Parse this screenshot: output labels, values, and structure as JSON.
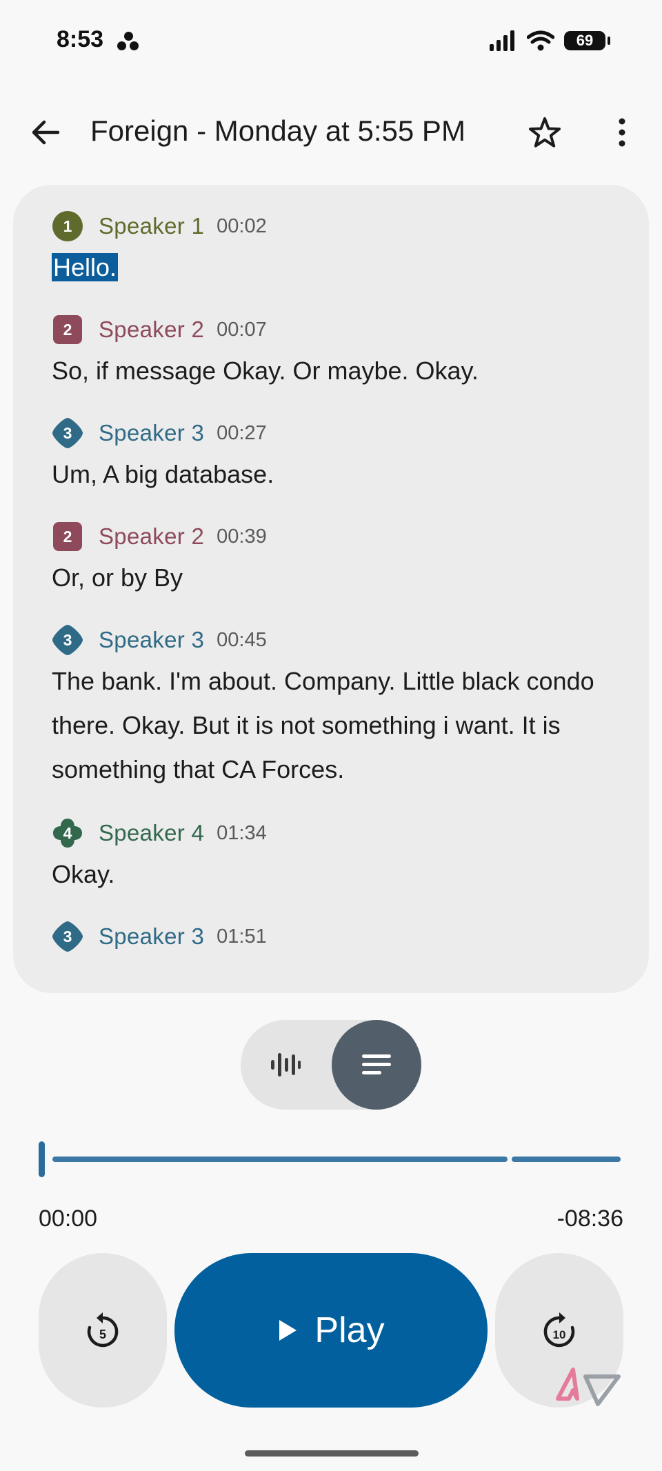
{
  "status_bar": {
    "time": "8:53",
    "battery": "69"
  },
  "header": {
    "title": "Foreign - Monday at 5:55 PM"
  },
  "transcript": [
    {
      "speaker_number": "1",
      "speaker": "Speaker 1",
      "time": "00:02",
      "text": "Hello.",
      "color": "#5f6b2c",
      "badge_shape": "circle"
    },
    {
      "speaker_number": "2",
      "speaker": "Speaker 2",
      "time": "00:07",
      "text": "So, if message Okay. Or maybe. Okay.",
      "color": "#8e4a5b",
      "badge_shape": "rounded-square"
    },
    {
      "speaker_number": "3",
      "speaker": "Speaker 3",
      "time": "00:27",
      "text": "Um, A big database.",
      "color": "#2f6a86",
      "badge_shape": "diamond"
    },
    {
      "speaker_number": "2",
      "speaker": "Speaker 2",
      "time": "00:39",
      "text": "Or, or by By",
      "color": "#8e4a5b",
      "badge_shape": "rounded-square"
    },
    {
      "speaker_number": "3",
      "speaker": "Speaker 3",
      "time": "00:45",
      "text": "The bank. I'm about. Company. Little black condo there. Okay. But it is not something i want. It is something that CA Forces.",
      "color": "#2f6a86",
      "badge_shape": "diamond"
    },
    {
      "speaker_number": "4",
      "speaker": "Speaker 4",
      "time": "01:34",
      "text": "Okay.",
      "color": "#32694d",
      "badge_shape": "clover"
    },
    {
      "speaker_number": "3",
      "speaker": "Speaker 3",
      "time": "01:51",
      "text": "",
      "color": "#2f6a86",
      "badge_shape": "diamond"
    }
  ],
  "player": {
    "current_time": "00:00",
    "remaining_time": "-08:36",
    "progress_fraction": 0,
    "play_label": "Play",
    "rewind_seconds": "5",
    "forward_seconds": "10"
  },
  "colors": {
    "accent": "#02609e",
    "seek_track": "#3b78a6",
    "toggle_active": "#525f6b"
  }
}
